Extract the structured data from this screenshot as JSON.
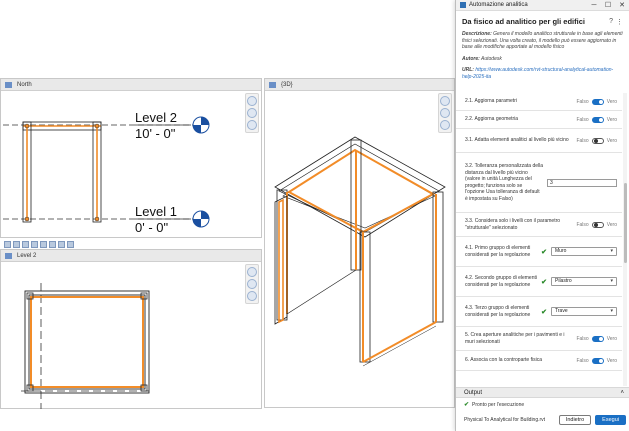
{
  "views": {
    "elevation": {
      "title": "North",
      "level2_name": "Level 2",
      "level2_elev": "10' - 0\"",
      "level1_name": "Level 1",
      "level1_elev": "0' - 0\""
    },
    "plan": {
      "title": "Level 2"
    },
    "view3d": {
      "title": "{3D}"
    }
  },
  "dialog": {
    "window_title": "Automazione analitica",
    "title": "Da fisico ad analitico per gli edifici",
    "description_label": "Descrizione:",
    "description": "Genera il modello analitico strutturale in base agli elementi fisici selezionati. Una volta creato, il modello può essere aggiornato in base alle modifiche apportate al modello fisico",
    "author_label": "Autore:",
    "author": "Autodesk",
    "url_label": "URL:",
    "url": "https://www.autodesk.com/rvt-structural-analytical-automation-help-2025-ita",
    "rows": [
      {
        "label": "2.1. Aggiorna parametri",
        "type": "toggle",
        "off": "Falso",
        "on": "Vero",
        "state": "on"
      },
      {
        "label": "2.2. Aggiorna geometria",
        "type": "toggle",
        "off": "Falso",
        "on": "Vero",
        "state": "on"
      },
      {
        "label": "3.1. Adatta elementi analitici al livello più vicino",
        "type": "toggle",
        "off": "Falso",
        "on": "Vero",
        "state": "off"
      },
      {
        "label": "3.2. Tolleranza personalizzata della distanza dal livello più vicino (valore in unità Lunghezza del progetto; funziona solo se l'opzione Usa tolleranza di default è impostata su Falso)",
        "type": "input",
        "value": "3"
      },
      {
        "label": "3.3. Considera solo i livelli con il parametro \"strutturale\" selezionato",
        "type": "toggle",
        "off": "Falso",
        "on": "Vero",
        "state": "off"
      },
      {
        "label": "4.1. Primo gruppo di elementi considerati per la regolazione",
        "type": "select",
        "value": "Muro"
      },
      {
        "label": "4.2. Secondo gruppo di elementi considerati per la regolazione",
        "type": "select",
        "value": "Pilastro"
      },
      {
        "label": "4.3. Terzo gruppo di elementi considerati per la regolazione",
        "type": "select",
        "value": "Trave"
      },
      {
        "label": "5. Crea aperture analitiche per i pavimenti e i muri selezionati",
        "type": "toggle",
        "off": "Falso",
        "on": "Vero",
        "state": "on"
      },
      {
        "label": "6. Associa con la controparte fisica",
        "type": "toggle",
        "off": "Falso",
        "on": "Vero",
        "state": "on"
      }
    ],
    "output_label": "Output",
    "status": "Pronto per l'esecuzione",
    "file": "Physical To Analytical for Building.rvt",
    "back_label": "Indietro",
    "run_label": "Esegui"
  },
  "colors": {
    "accent": "#1a6fc4",
    "analytical": "#f28c28"
  }
}
